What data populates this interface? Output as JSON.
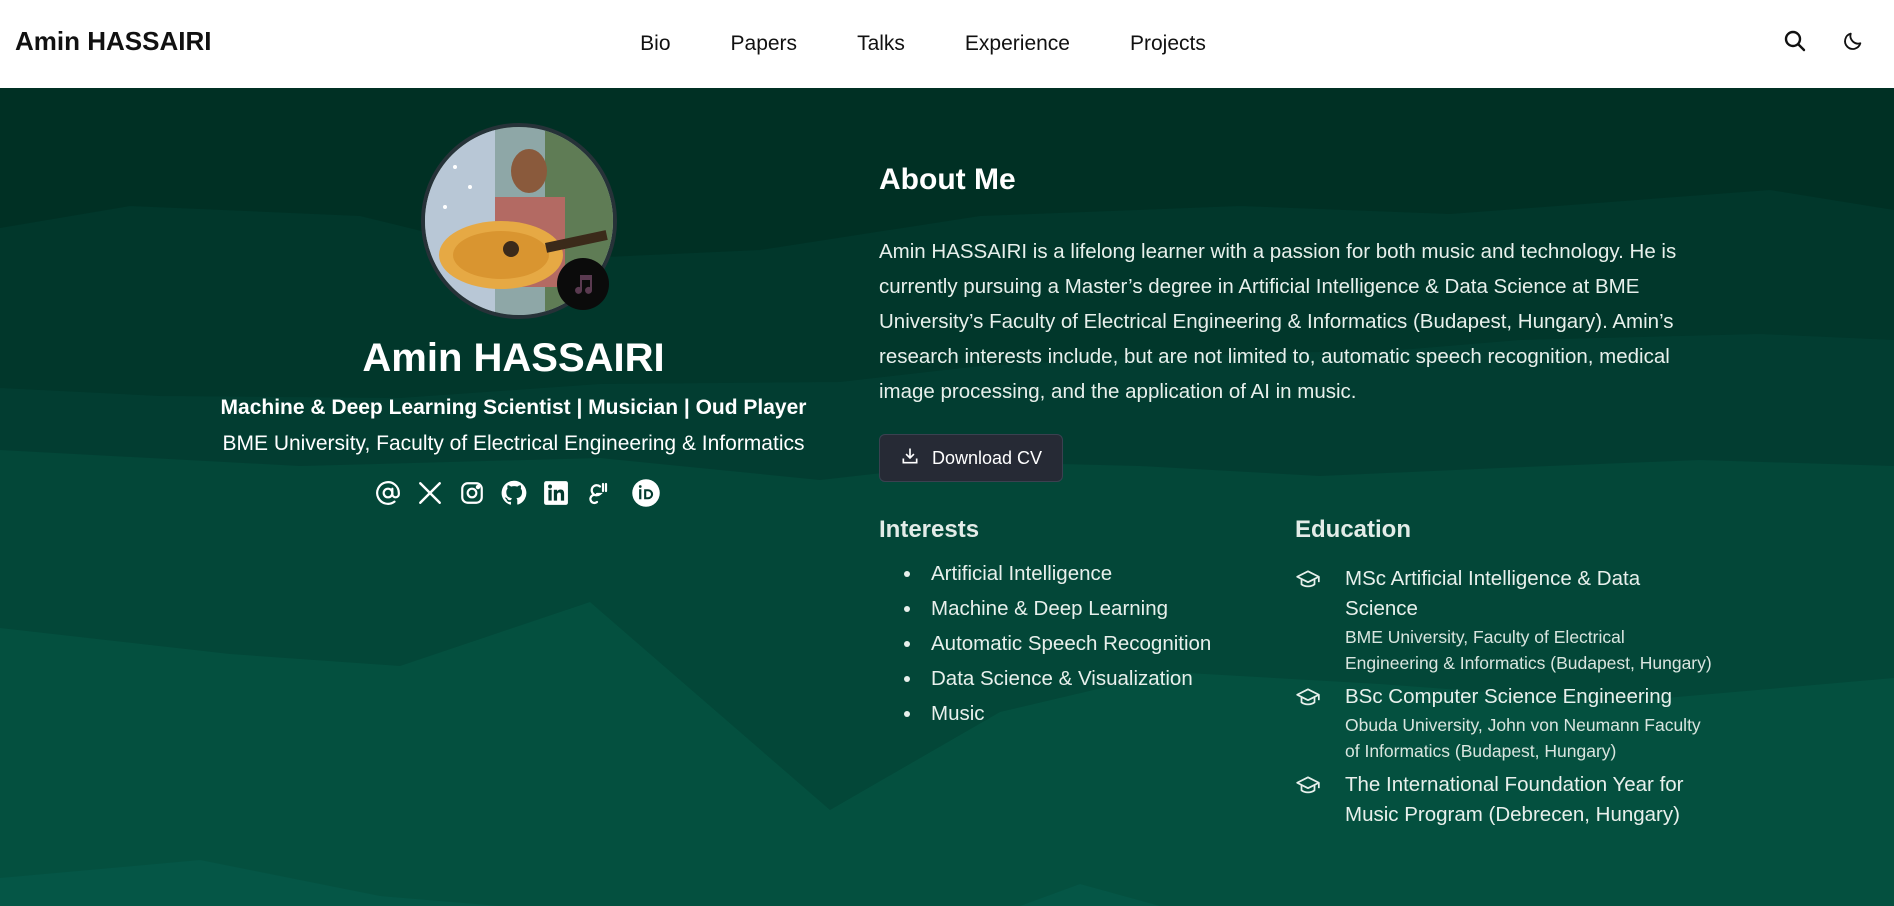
{
  "navbar": {
    "brand": "Amin HASSAIRI",
    "links": [
      "Bio",
      "Papers",
      "Talks",
      "Experience",
      "Projects"
    ],
    "icons": [
      "search-icon",
      "moon-icon"
    ]
  },
  "profile": {
    "name": "Amin HASSAIRI",
    "role": "Machine & Deep Learning Scientist | Musician | Oud Player",
    "organization": "BME University, Faculty of Electrical Engineering & Informatics",
    "avatar_badge_icon": "music-note-icon",
    "socials": [
      "email-icon",
      "x-twitter-icon",
      "instagram-icon",
      "github-icon",
      "linkedin-icon",
      "google-scholar-icon",
      "orcid-icon"
    ]
  },
  "about": {
    "title": "About Me",
    "text": "Amin HASSAIRI is a lifelong learner with a passion for both music and technology. He is currently pursuing a Master’s degree in Artificial Intelligence & Data Science at BME University’s Faculty of Electrical Engineering & Informatics (Budapest, Hungary). Amin’s research interests include, but are not limited to, automatic speech recognition, medical image processing, and the application of AI in music.",
    "cv_button": "Download CV"
  },
  "interests": {
    "title": "Interests",
    "items": [
      "Artificial Intelligence",
      "Machine & Deep Learning",
      "Automatic Speech Recognition",
      "Data Science & Visualization",
      "Music"
    ]
  },
  "education": {
    "title": "Education",
    "items": [
      {
        "degree": "MSc Artificial Intelligence & Data Science",
        "school": "BME University, Faculty of Electrical Engineering & Informatics (Budapest, Hungary)"
      },
      {
        "degree": "BSc Computer Science Engineering",
        "school": "Obuda University, John von Neumann Faculty of Informatics (Budapest, Hungary)"
      },
      {
        "degree": "The International Foundation Year for Music Program (Debrecen, Hungary)",
        "school": ""
      }
    ]
  },
  "colors": {
    "hero_dark": "#003024",
    "hero_mid": "#024a3d",
    "button_bg": "#262a35"
  }
}
